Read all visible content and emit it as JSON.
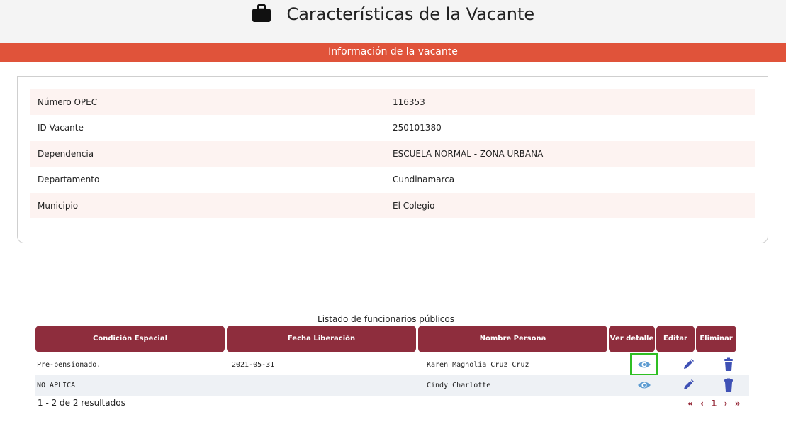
{
  "header": {
    "title": "Características de la Vacante",
    "icon": "briefcase-icon"
  },
  "section": {
    "title": "Información de la vacante",
    "color": "#e0533a"
  },
  "vacancy": [
    {
      "label": "Número OPEC",
      "value": "116353"
    },
    {
      "label": "ID Vacante",
      "value": "250101380"
    },
    {
      "label": "Dependencia",
      "value": "ESCUELA NORMAL - ZONA URBANA"
    },
    {
      "label": "Departamento",
      "value": "Cundinamarca"
    },
    {
      "label": "Municipio",
      "value": "El Colegio"
    }
  ],
  "list": {
    "caption": "Listado de funcionarios públicos",
    "header_color": "#8e2d3d",
    "columns": [
      "Condición Especial",
      "Fecha Liberación",
      "Nombre Persona",
      "Ver detalle",
      "Editar",
      "Eliminar"
    ],
    "rows": [
      {
        "condicion": "Pre-pensionado.",
        "fecha": "2021-05-31",
        "nombre": "Karen Magnolia Cruz Cruz"
      },
      {
        "condicion": "NO APLICA",
        "fecha": "",
        "nombre": "Cindy Charlotte"
      }
    ],
    "results_text": "1 - 2 de 2 resultados",
    "pager": {
      "first": "«",
      "prev": "‹",
      "page": "1",
      "next": "›",
      "last": "»"
    }
  }
}
